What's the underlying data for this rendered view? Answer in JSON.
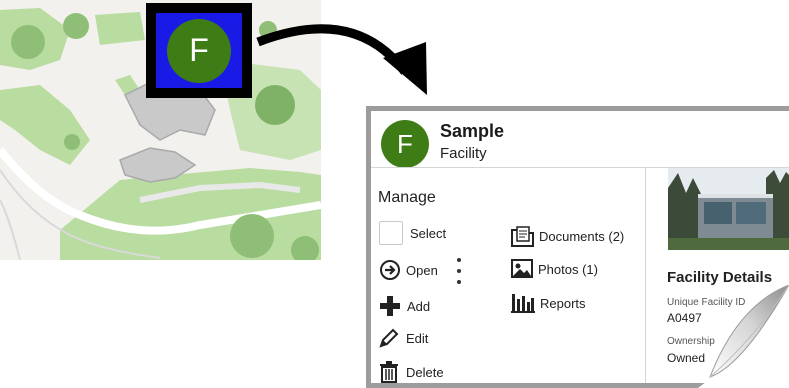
{
  "marker": {
    "letter": "F"
  },
  "card": {
    "avatar_letter": "F",
    "title": "Sample",
    "subtitle": "Facility",
    "manage_heading": "Manage",
    "actions": {
      "select": "Select",
      "open": "Open",
      "add": "Add",
      "edit": "Edit",
      "delete": "Delete",
      "documents": "Documents (2)",
      "photos": "Photos (1)",
      "reports": "Reports"
    },
    "details_heading": "Facility Details",
    "unique_label": "Unique Facility ID",
    "unique_value": "A0497",
    "ownership_label": "Ownership",
    "ownership_value": "Owned"
  },
  "colors": {
    "marker_bg": "#1a1ae6",
    "avatar_green": "#3e7d16",
    "card_border": "#9c9c9c"
  }
}
